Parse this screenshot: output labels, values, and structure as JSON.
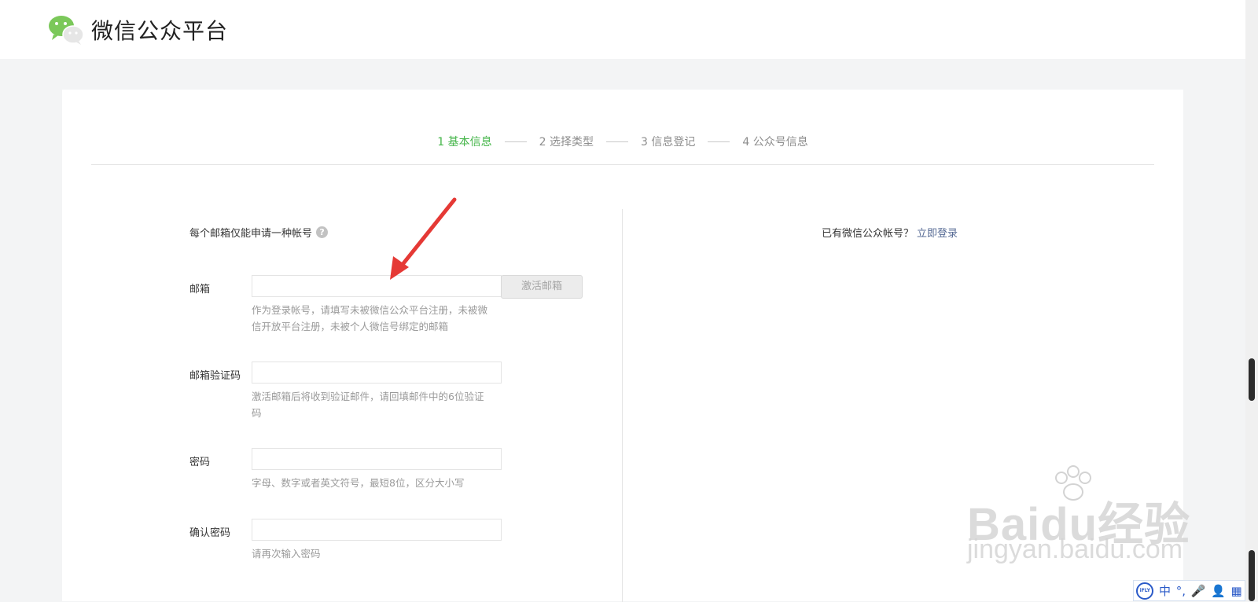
{
  "header": {
    "brand": "微信公众平台",
    "logo_icon": "wechat-logo-icon"
  },
  "steps": [
    {
      "label": "1 基本信息",
      "active": true
    },
    {
      "label": "2 选择类型",
      "active": false
    },
    {
      "label": "3 信息登记",
      "active": false
    },
    {
      "label": "4 公众号信息",
      "active": false
    }
  ],
  "form": {
    "notice": "每个邮箱仅能申请一种帐号",
    "help_icon": "question-icon",
    "email": {
      "label": "邮箱",
      "value": "",
      "tips": "作为登录帐号，请填写未被微信公众平台注册，未被微信开放平台注册，未被个人微信号绑定的邮箱",
      "activate_button": "激活邮箱"
    },
    "verify_code": {
      "label": "邮箱验证码",
      "value": "",
      "tips": "激活邮箱后将收到验证邮件，请回填邮件中的6位验证码"
    },
    "password": {
      "label": "密码",
      "value": "",
      "tips": "字母、数字或者英文符号，最短8位，区分大小写"
    },
    "confirm_password": {
      "label": "确认密码",
      "value": "",
      "tips": "请再次输入密码"
    }
  },
  "login": {
    "hint": "已有微信公众帐号？",
    "link": "立即登录"
  },
  "watermark": {
    "main": "Baidu经验",
    "sub": "jingyan.baidu.com"
  },
  "ime": {
    "items": [
      "中",
      "°,",
      "🎤",
      "👤",
      "▦"
    ]
  },
  "colors": {
    "accent": "#44b549",
    "link": "#576b95",
    "arrow": "#e53935"
  }
}
